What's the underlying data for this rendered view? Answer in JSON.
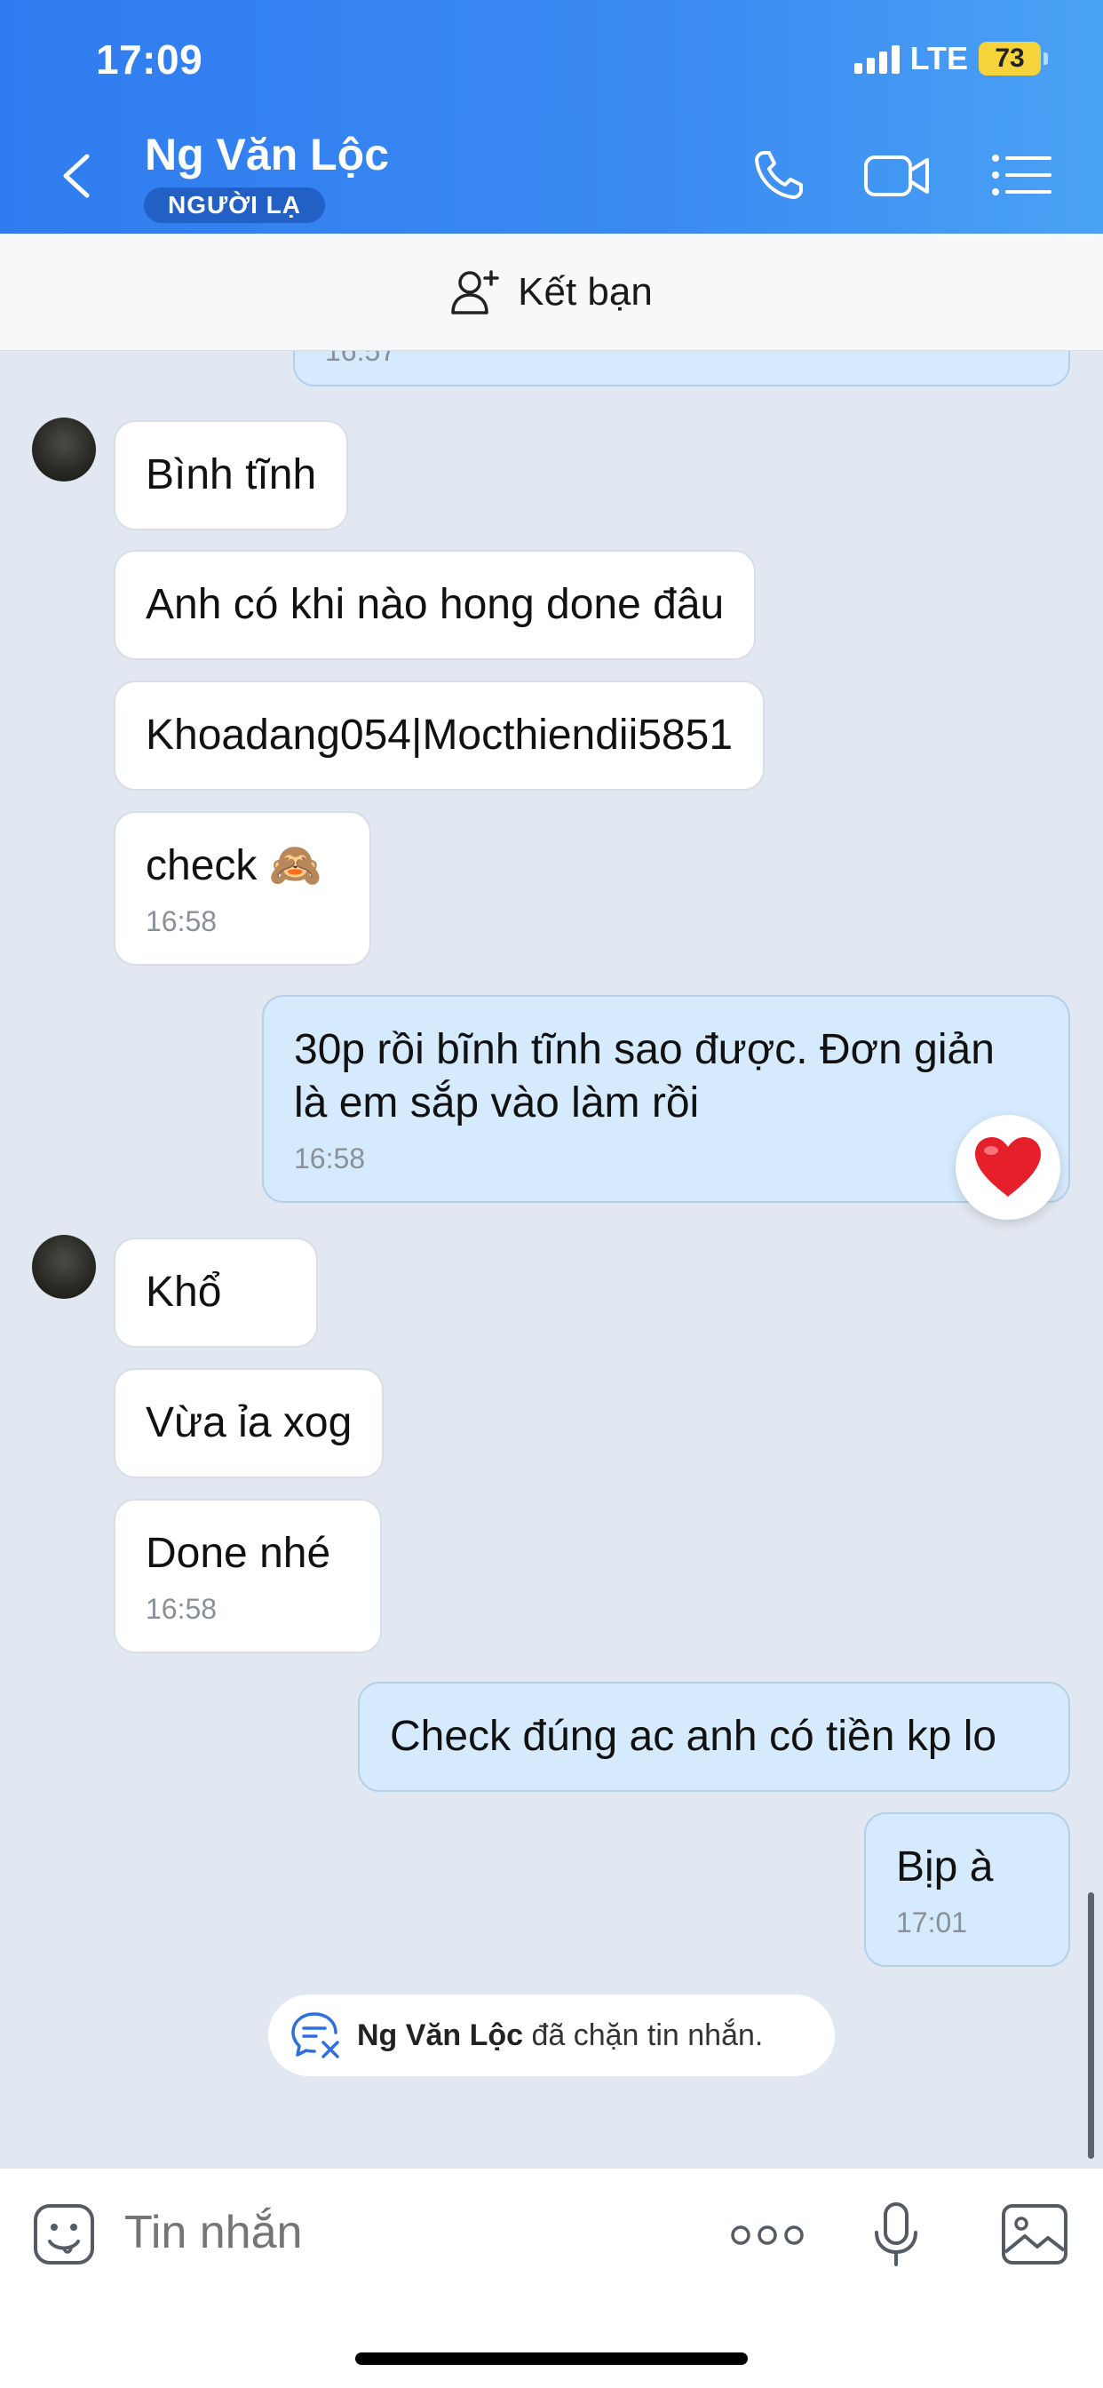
{
  "status_bar": {
    "time": "17:09",
    "network": "LTE",
    "battery": "73"
  },
  "header": {
    "contact_name": "Ng Văn Lộc",
    "badge": "NGƯỜI LẠ"
  },
  "add_friend": {
    "label": "Kết bạn"
  },
  "messages": {
    "partial_time": "16:57",
    "m1": "Bình tĩnh",
    "m2": "Anh có khi nào hong done đâu",
    "m3": "Khoadang054|Mocthiendii5851",
    "m4": "check 🙈",
    "m4_time": "16:58",
    "m5_line1": "30p rồi bĩnh tĩnh sao được. Đơn giản",
    "m5_line2": "là em sắp vào làm rồi",
    "m5_time": "16:58",
    "m6": "Khổ",
    "m7": "Vừa ỉa xog",
    "m8": "Done nhé",
    "m8_time": "16:58",
    "m9": "Check đúng ac anh có tiền kp lo",
    "m10": "Bịp à",
    "m10_time": "17:01"
  },
  "blocked_notice": {
    "name": "Ng Văn Lộc",
    "text": " đã chặn tin nhắn."
  },
  "input": {
    "placeholder": "Tin nhắn"
  },
  "colors": {
    "header_start": "#2f7cf0",
    "outgoing_bubble": "#d5eafc",
    "incoming_bubble": "#ffffff",
    "background": "#e2e8f1"
  }
}
